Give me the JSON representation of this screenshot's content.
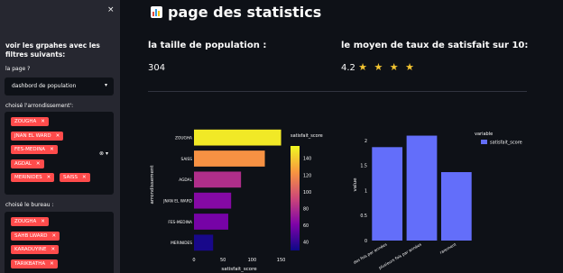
{
  "sidebar": {
    "close_icon": "×",
    "title": "voir les grpahes avec les filtres suivants:",
    "page_label": "la page ?",
    "page_value": "dashbord de population",
    "arr_label": "choisé l'arrondissement':",
    "arr_chips": [
      "ZOUGHA",
      "JNAN EL WARD",
      "FES-MEDINA",
      "AGDAL",
      "MERINIDES",
      "SAISS"
    ],
    "bureau_label": "choisé le bureau :",
    "bureau_chips": [
      "ZOUGHA",
      "SAHB LWARD",
      "KARAOUYINE",
      "TARIKBATHA"
    ]
  },
  "main": {
    "title": "page des statistics",
    "metric1_label": "la taille de population :",
    "metric1_value": "304",
    "metric2_label": "le moyen de taux de satisfait sur 10:",
    "metric2_value": "4.2",
    "stars": "★ ★ ★ ★"
  },
  "chart_data": [
    {
      "type": "bar",
      "orientation": "horizontal",
      "categories": [
        "ZOUGHA",
        "SAISS",
        "AGDAL",
        "JNAN EL WARD",
        "FES-MEDINA",
        "MERINIDES"
      ],
      "values": [
        150,
        122,
        81,
        64,
        59,
        33
      ],
      "xlabel": "satisfait_score",
      "ylabel": "arrondissement",
      "xticks": [
        "0",
        "50",
        "100",
        "150"
      ],
      "xlim": [
        0,
        160
      ],
      "colorbar": {
        "title": "satisfait_score",
        "ticks": [
          "140",
          "120",
          "100",
          "80",
          "60",
          "40"
        ]
      }
    },
    {
      "type": "bar",
      "categories": [
        "des fois par années",
        "plusieurs fois par années",
        "rarement"
      ],
      "values": [
        1.87,
        2.1,
        1.37
      ],
      "xlabel": "",
      "ylabel": "value",
      "yticks": [
        "0",
        "0.5",
        "1",
        "1.5",
        "2"
      ],
      "ylim": [
        0,
        2.2
      ],
      "legend": {
        "title": "variable",
        "entries": [
          "satisfait_score"
        ]
      },
      "color": "#636efa"
    }
  ]
}
